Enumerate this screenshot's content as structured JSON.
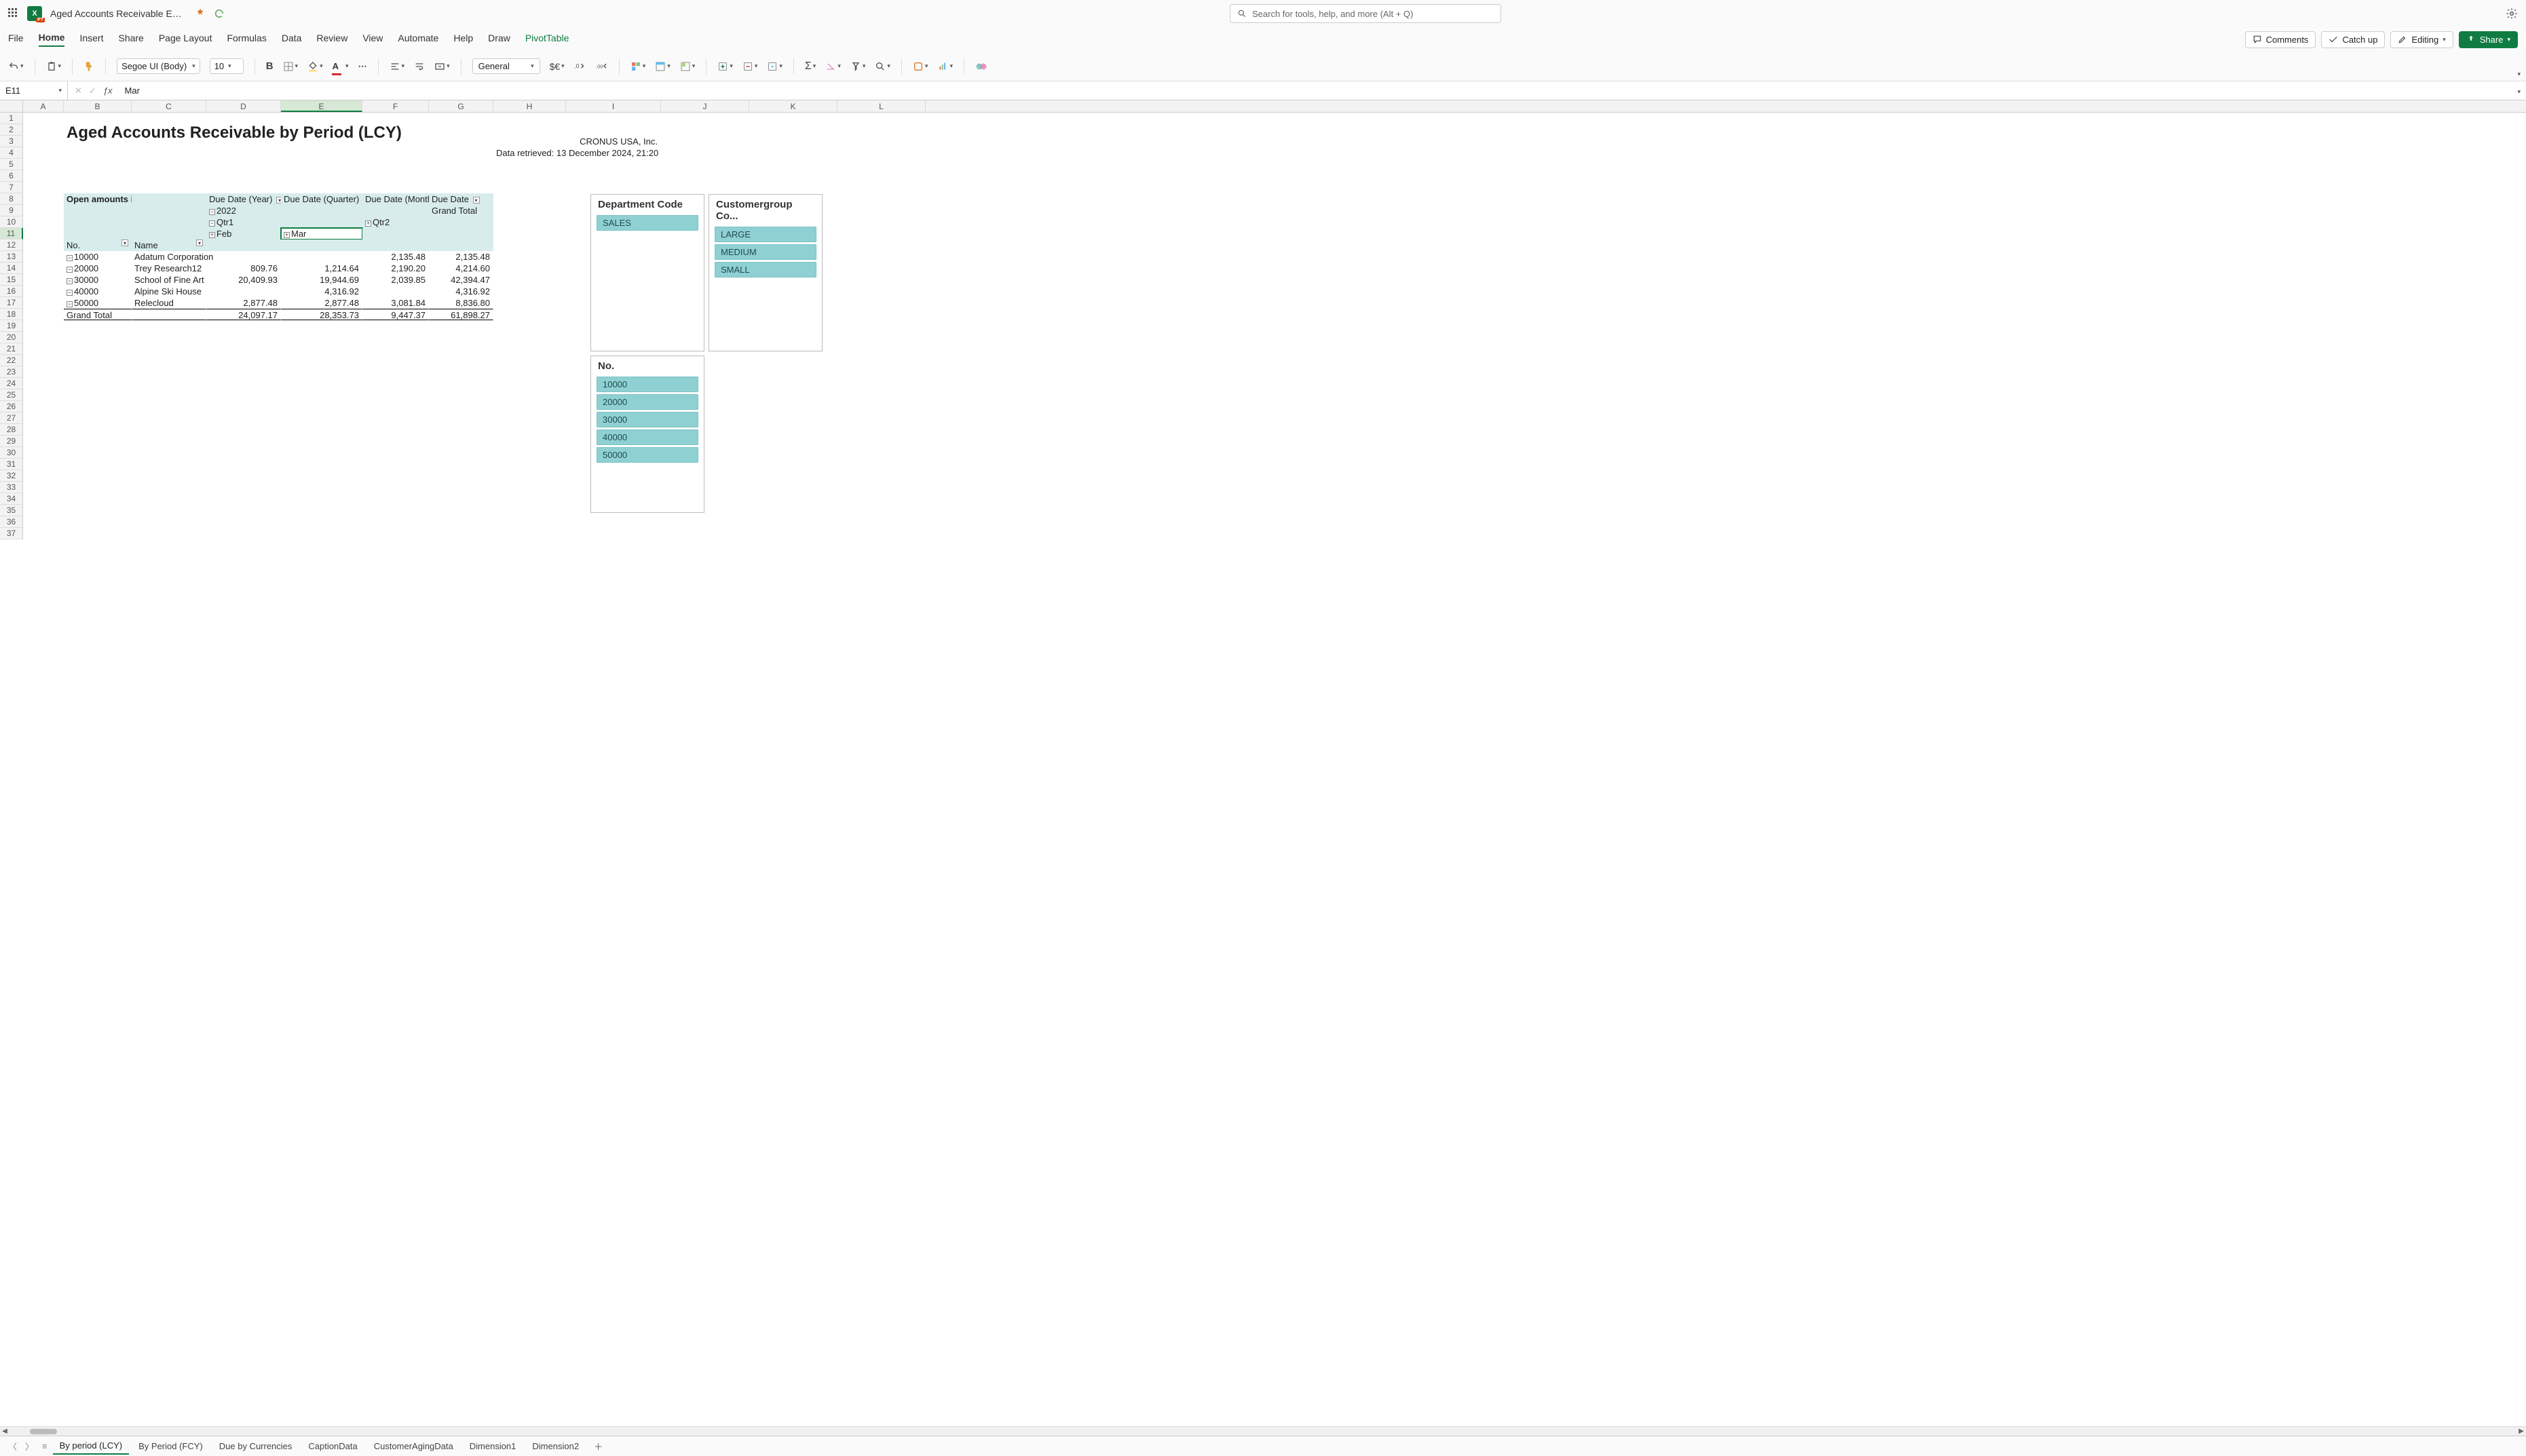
{
  "titlebar": {
    "doc_title": "Aged Accounts Receivable Excel (",
    "search_placeholder": "Search for tools, help, and more (Alt + Q)"
  },
  "ribbon": {
    "tabs": [
      "File",
      "Home",
      "Insert",
      "Share",
      "Page Layout",
      "Formulas",
      "Data",
      "Review",
      "View",
      "Automate",
      "Help",
      "Draw",
      "PivotTable"
    ],
    "active_tab": "Home",
    "comments": "Comments",
    "catchup": "Catch up",
    "editing": "Editing",
    "share": "Share"
  },
  "toolbar": {
    "font": "Segoe UI (Body)",
    "font_size": "10",
    "num_format": "General"
  },
  "formula": {
    "namebox": "E11",
    "value": "Mar"
  },
  "columns": [
    "A",
    "B",
    "C",
    "D",
    "E",
    "F",
    "G",
    "H",
    "I",
    "J",
    "K",
    "L"
  ],
  "report": {
    "title": "Aged Accounts Receivable by Period (LCY)",
    "company": "CRONUS USA, Inc.",
    "retrieved": "Data retrieved: 13 December 2024, 21:20",
    "open_label": "Open amounts in LCY",
    "due_year": "Due Date (Year)",
    "due_quarter": "Due Date (Quarter)",
    "due_month": "Due Date (Month)",
    "due_date": "Due Date",
    "year": "2022",
    "grand_total_label": "Grand Total",
    "qtr1": "Qtr1",
    "qtr2": "Qtr2",
    "feb": "Feb",
    "mar": "Mar",
    "no_label": "No.",
    "name_label": "Name",
    "rows": [
      {
        "no": "10000",
        "name": "Adatum Corporation",
        "d": "",
        "e": "",
        "f": "2,135.48",
        "g": "2,135.48"
      },
      {
        "no": "20000",
        "name": "Trey Research12",
        "d": "809.76",
        "e": "1,214.64",
        "f": "2,190.20",
        "g": "4,214.60"
      },
      {
        "no": "30000",
        "name": "School of Fine Art",
        "d": "20,409.93",
        "e": "19,944.69",
        "f": "2,039.85",
        "g": "42,394.47"
      },
      {
        "no": "40000",
        "name": "Alpine Ski House",
        "d": "",
        "e": "4,316.92",
        "f": "",
        "g": "4,316.92"
      },
      {
        "no": "50000",
        "name": "Relecloud",
        "d": "2,877.48",
        "e": "2,877.48",
        "f": "3,081.84",
        "g": "8,836.80"
      }
    ],
    "grand": {
      "label": "Grand Total",
      "d": "24,097.17",
      "e": "28,353.73",
      "f": "9,447.37",
      "g": "61,898.27"
    }
  },
  "slicers": {
    "dept_title": "Department Code",
    "dept_items": [
      "SALES"
    ],
    "cust_title": "Customergroup Co...",
    "cust_items": [
      "LARGE",
      "MEDIUM",
      "SMALL"
    ],
    "no_title": "No.",
    "no_items": [
      "10000",
      "20000",
      "30000",
      "40000",
      "50000"
    ]
  },
  "sheets": {
    "tabs": [
      "By period (LCY)",
      "By Period (FCY)",
      "Due by Currencies",
      "CaptionData",
      "CustomerAgingData",
      "Dimension1",
      "Dimension2"
    ],
    "active": "By period (LCY)"
  }
}
